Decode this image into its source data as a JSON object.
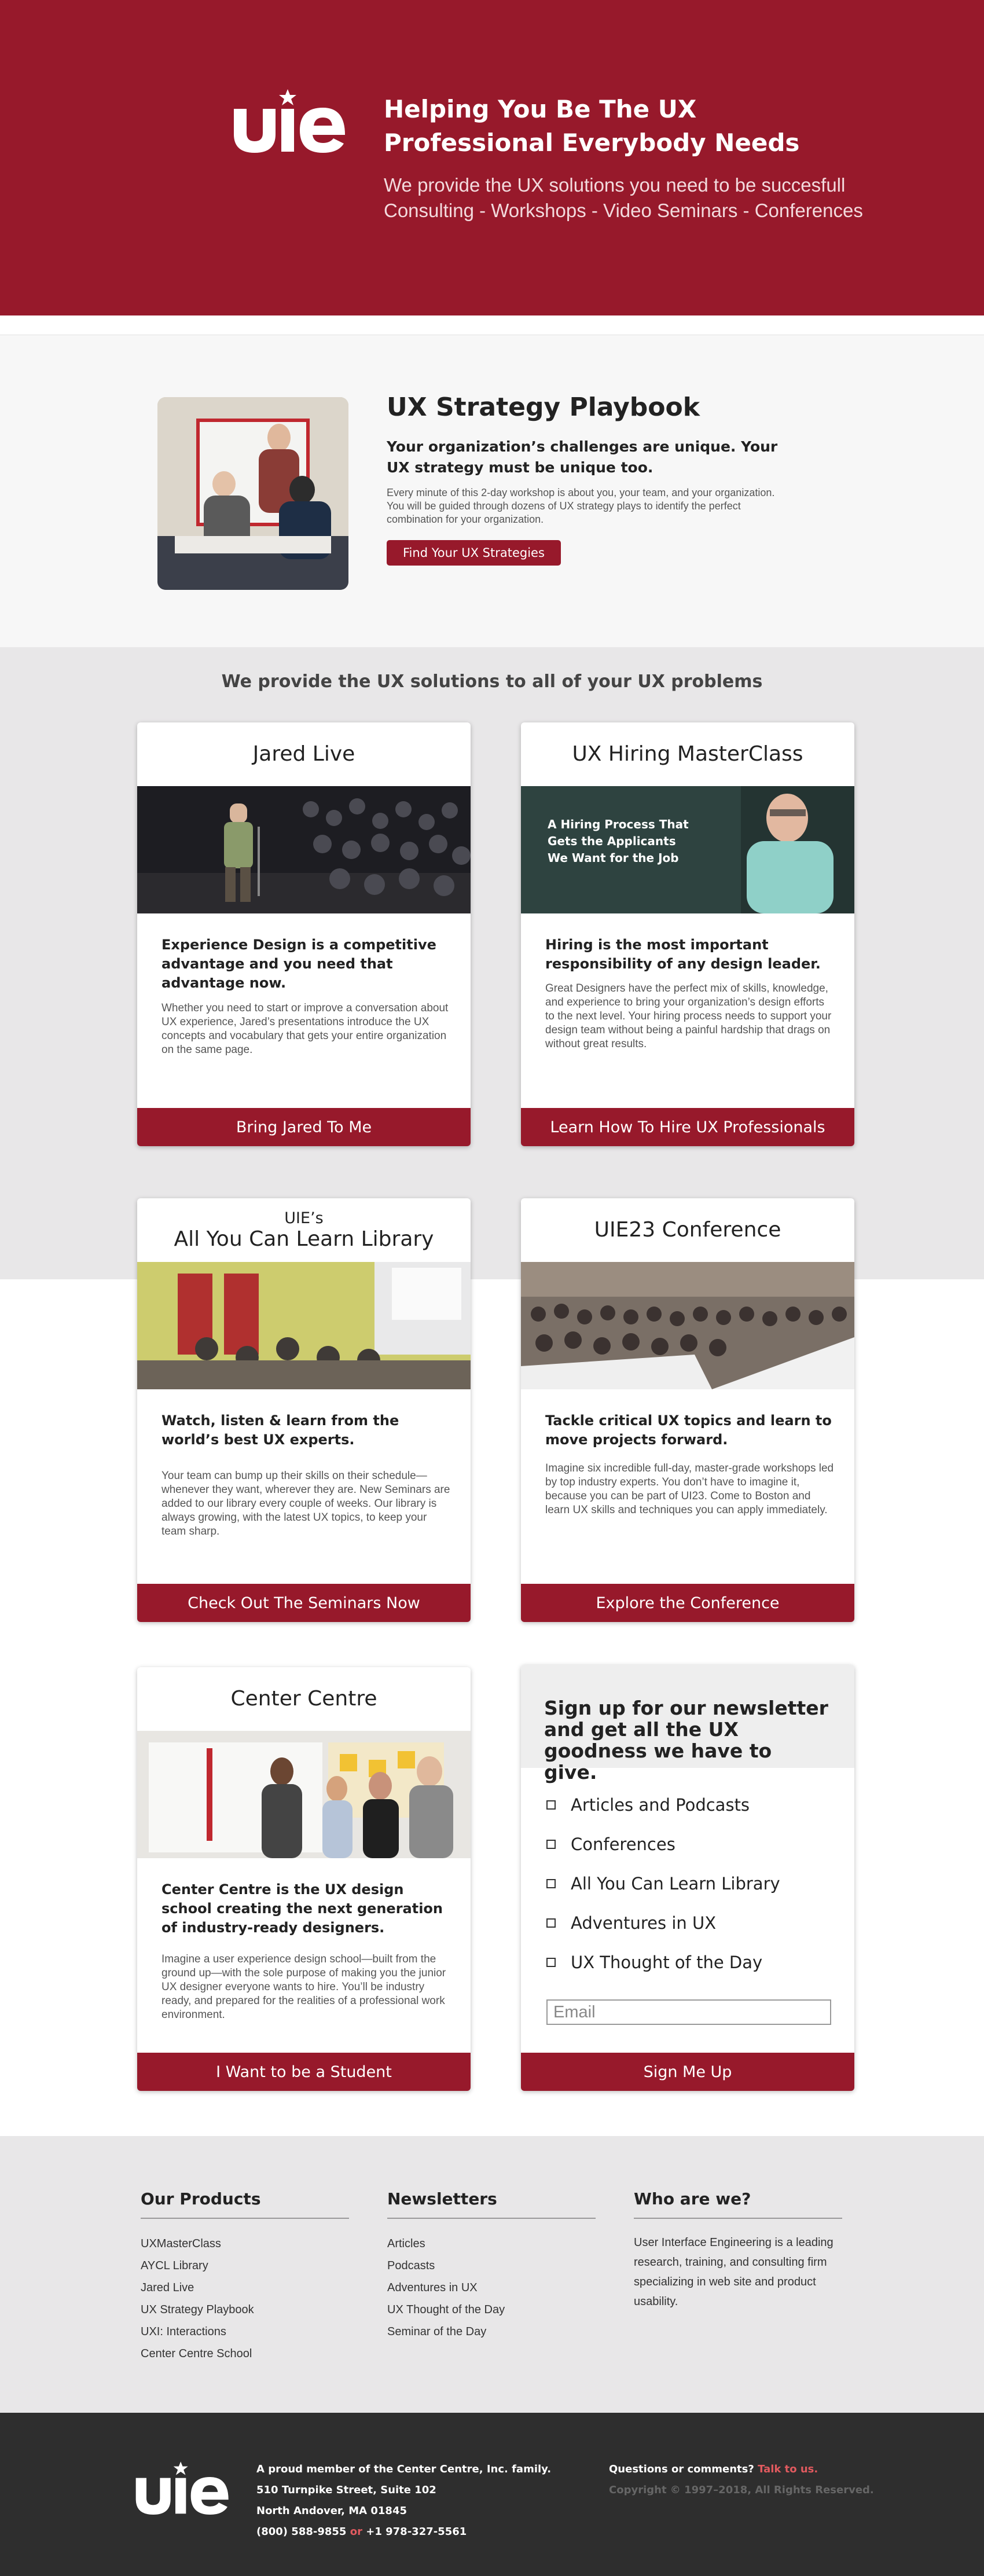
{
  "hero": {
    "title_line1": "Helping You Be The UX",
    "title_line2": "Professional Everybody Needs",
    "sub_line1": "We provide the UX solutions you need to be succesfull",
    "sub_line2": "Consulting - Workshops - Video Seminars - Conferences",
    "logo_text": "uie"
  },
  "playbook": {
    "title": "UX Strategy Playbook",
    "lead": "Your organization’s challenges are unique. Your UX strategy must be unique too.",
    "body": "Every minute of this 2-day workshop is about you, your team, and your organization. You will be guided through dozens of UX strategy plays to identify the perfect combination for your organization.",
    "button": "Find Your UX Strategies"
  },
  "services": {
    "title": "We provide the UX solutions to all of your UX problems",
    "cards": [
      {
        "title": "Jared Live",
        "lead": "Experience Design is a competitive advantage and you need that advantage now.",
        "body": "Whether you need to start or improve a conversation about UX experience, Jared’s presentations introduce the UX concepts and vocabulary that gets your entire organization on the same page.",
        "button": "Bring Jared To Me"
      },
      {
        "title": "UX Hiring MasterClass",
        "slide_line1": "A Hiring Process That",
        "slide_line2": "Gets the Applicants",
        "slide_line3": "We Want for the Job",
        "lead": "Hiring is the most important responsibility of any design leader.",
        "body": "Great Designers have the perfect mix of skills, knowledge, and experience to bring your organization’s design efforts to the next level. Your hiring process needs to support your design team without being a painful hardship that drags on without great results.",
        "button": "Learn How To Hire UX Professionals"
      },
      {
        "title_small": "UIE’s",
        "title": "All You Can Learn Library",
        "lead": "Watch, listen & learn from the world’s best UX experts.",
        "body": "Your team can bump up their skills on their schedule—whenever they want, wherever they are. New Seminars are added to our library every couple of weeks. Our library is always growing, with the latest UX topics, to keep your team sharp.",
        "button": "Check Out The Seminars Now"
      },
      {
        "title": "UIE23 Conference",
        "lead": "Tackle critical UX topics and  learn to move projects forward.",
        "body": "Imagine six incredible full-day, master-grade workshops led by top industry experts. You don’t have to imagine it, because you can be part of UI23. Come to Boston and learn UX skills and techniques you can apply immediately.",
        "button": "Explore the Conference"
      },
      {
        "title": "Center Centre",
        "lead": "Center Centre is the UX design school creating the next generation of industry-ready designers.",
        "body": "Imagine a user experience design school—built from the ground up—with the sole purpose of making you the  junior UX designer everyone wants to hire. You’ll be  industry ready, and  prepared for the realities of a professional work environment.",
        "button": "I Want to be a Student"
      }
    ]
  },
  "newsletter": {
    "title": "Sign up for our newsletter and get all the UX goodness we have to give.",
    "options": [
      "Articles and Podcasts",
      "Conferences",
      "All You Can Learn Library",
      "Adventures in UX",
      "UX Thought of the Day"
    ],
    "email_placeholder": "Email",
    "button": "Sign Me Up"
  },
  "footer": {
    "products_title": "Our Products",
    "products": [
      "UXMasterClass",
      "AYCL Library",
      "Jared Live",
      "UX Strategy Playbook",
      "UXI: Interactions",
      "Center Centre School"
    ],
    "newsletters_title": "Newsletters",
    "newsletters": [
      "Articles",
      "Podcasts",
      "Adventures in UX",
      "UX Thought of the Day",
      "Seminar of the Day"
    ],
    "who_title": "Who are we?",
    "who_text": "User Interface Engineering is a leading research, training, and consulting firm specializing in web site and product usability."
  },
  "bottom": {
    "member": "A proud member of the Center Centre, Inc. family.",
    "street": "510 Turnpike Street, Suite 102",
    "city": "North Andover, MA 01845",
    "phone1": "(800) 588-9855",
    "or": "or",
    "phone2": "+1 978-327-5561",
    "questions": "Questions or comments?",
    "talk": "Talk to us.",
    "copyright": "Copyright © 1997–2018, All Rights Reserved."
  },
  "colors": {
    "brand": "#97192b",
    "accent": "#e15a5f",
    "services_bg": "#e8e7e8",
    "footer_dark": "#2e2e2e"
  }
}
